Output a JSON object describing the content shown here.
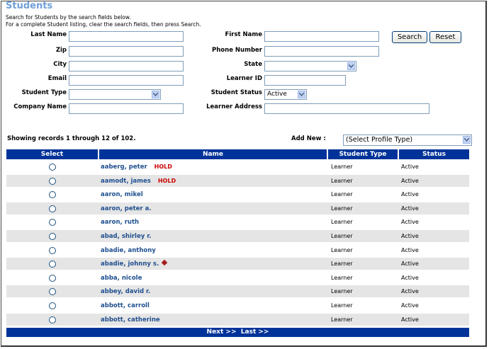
{
  "page": {
    "title": "Students",
    "instructions": [
      "Search for Students by the search fields below.",
      "For a complete Student listing, clear the search fields, then press Search."
    ]
  },
  "form": {
    "last_name_label": "Last Name",
    "first_name_label": "First Name",
    "zip_label": "Zip",
    "phone_label": "Phone Number",
    "city_label": "City",
    "state_label": "State",
    "email_label": "Email",
    "learner_id_label": "Learner ID",
    "student_type_label": "Student Type",
    "student_status_label": "Student Status",
    "student_status_value": "Active",
    "company_label": "Company Name",
    "learner_address_label": "Learner Address",
    "search_button": "Search",
    "reset_button": "Reset"
  },
  "list": {
    "showing_text": "Showing records 1 through 12 of 102.",
    "add_new_label": "Add New :",
    "profile_type_value": "(Select Profile Type)",
    "headers": {
      "select": "Select",
      "name": "Name",
      "type": "Student Type",
      "status": "Status"
    },
    "rows": [
      {
        "name": "aaberg, peter",
        "flag": "HOLD",
        "type": "Learner",
        "status": "Active"
      },
      {
        "name": "aamodt, james",
        "flag": "HOLD",
        "type": "Learner",
        "status": "Active"
      },
      {
        "name": "aaron, mikel",
        "flag": "",
        "type": "Learner",
        "status": "Active"
      },
      {
        "name": "aaron, peter a.",
        "flag": "",
        "type": "Learner",
        "status": "Active"
      },
      {
        "name": "aaron, ruth",
        "flag": "",
        "type": "Learner",
        "status": "Active"
      },
      {
        "name": "abad, shirley r.",
        "flag": "",
        "type": "Learner",
        "status": "Active"
      },
      {
        "name": "abadie, anthony",
        "flag": "",
        "type": "Learner",
        "status": "Active"
      },
      {
        "name": "abadie, johnny s.",
        "flag": "",
        "type": "Learner",
        "status": "Active"
      },
      {
        "name": "abba, nicole",
        "flag": "",
        "type": "Learner",
        "status": "Active"
      },
      {
        "name": "abbey, david r.",
        "flag": "",
        "type": "Learner",
        "status": "Active"
      },
      {
        "name": "abbott, carroll",
        "flag": "",
        "type": "Learner",
        "status": "Active"
      },
      {
        "name": "abbott, catherine",
        "flag": "",
        "type": "Learner",
        "status": "Active"
      }
    ],
    "next_label": "Next >>",
    "last_label": "Last >>"
  },
  "colors": {
    "header_bg": "#003399",
    "title": "#6f9fd8",
    "name_link": "#1f4f8f",
    "hold": "#cc0000",
    "alt_row": "#e5e5e5"
  }
}
